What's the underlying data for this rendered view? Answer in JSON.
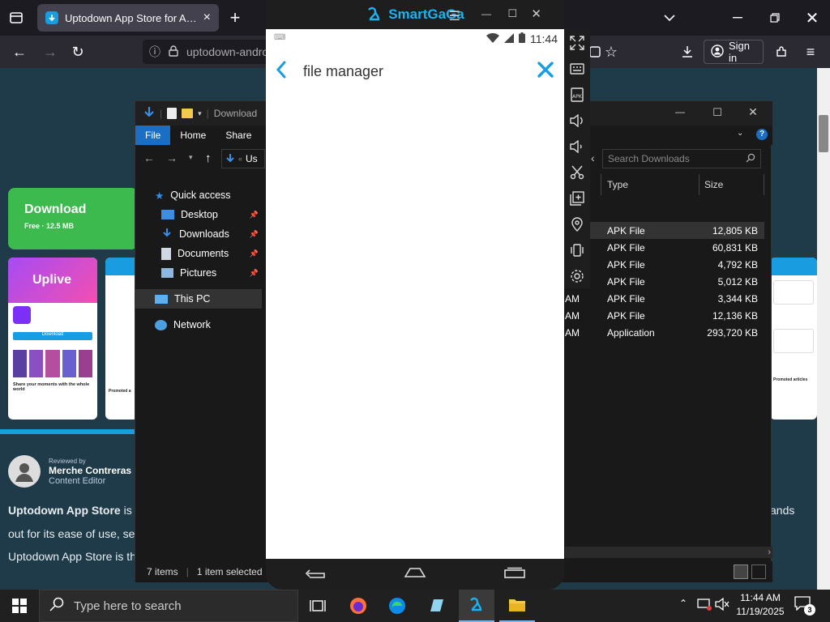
{
  "browser": {
    "tab_title": "Uptodown App Store for Android",
    "url": "uptodown-android",
    "sign_in": "Sign in"
  },
  "page": {
    "download_label": "Download",
    "download_sub": "Free · 12.5 MB",
    "reviewed_by": "Reviewed by",
    "reviewer_name": "Merche Contreras",
    "reviewer_role": "Content Editor",
    "para1_bold": "Uptodown App Store",
    "para1_rest": " is th",
    "para1_tail": "ands",
    "para2": "out for its ease of use, sec",
    "para3": "Uptodown App Store is th",
    "shot_app": "Uplive",
    "shot_caption": "Share your moments with the whole world",
    "shot_btn": "Download",
    "promoted": "Promoted articles",
    "promoted_short": "Promoted a"
  },
  "explorer": {
    "title": "Download",
    "ribbon": [
      "File",
      "Home",
      "Share"
    ],
    "address": "Us",
    "search_placeholder": "Search Downloads",
    "nav": {
      "quick_access": "Quick access",
      "items": [
        "Desktop",
        "Downloads",
        "Documents",
        "Pictures"
      ],
      "this_pc": "This PC",
      "network": "Network"
    },
    "columns": {
      "type": "Type",
      "size": "Size"
    },
    "rows": [
      {
        "date": "",
        "type": "APK File",
        "size": "12,805 KB"
      },
      {
        "date": "",
        "type": "APK File",
        "size": "60,831 KB"
      },
      {
        "date": "",
        "type": "APK File",
        "size": "4,792 KB"
      },
      {
        "date": "",
        "type": "APK File",
        "size": "5,012 KB"
      },
      {
        "date": "AM",
        "type": "APK File",
        "size": "3,344 KB"
      },
      {
        "date": "AM",
        "type": "APK File",
        "size": "12,136 KB"
      },
      {
        "date": "AM",
        "type": "Application",
        "size": "293,720 KB"
      }
    ],
    "status_items": "7 items",
    "status_selected": "1 item selected"
  },
  "emulator": {
    "brand": "SmartGaGa",
    "time": "11:44",
    "query": "file manager"
  },
  "taskbar": {
    "search_placeholder": "Type here to search",
    "time": "11:44 AM",
    "date": "11/19/2025",
    "notifications": "3"
  }
}
